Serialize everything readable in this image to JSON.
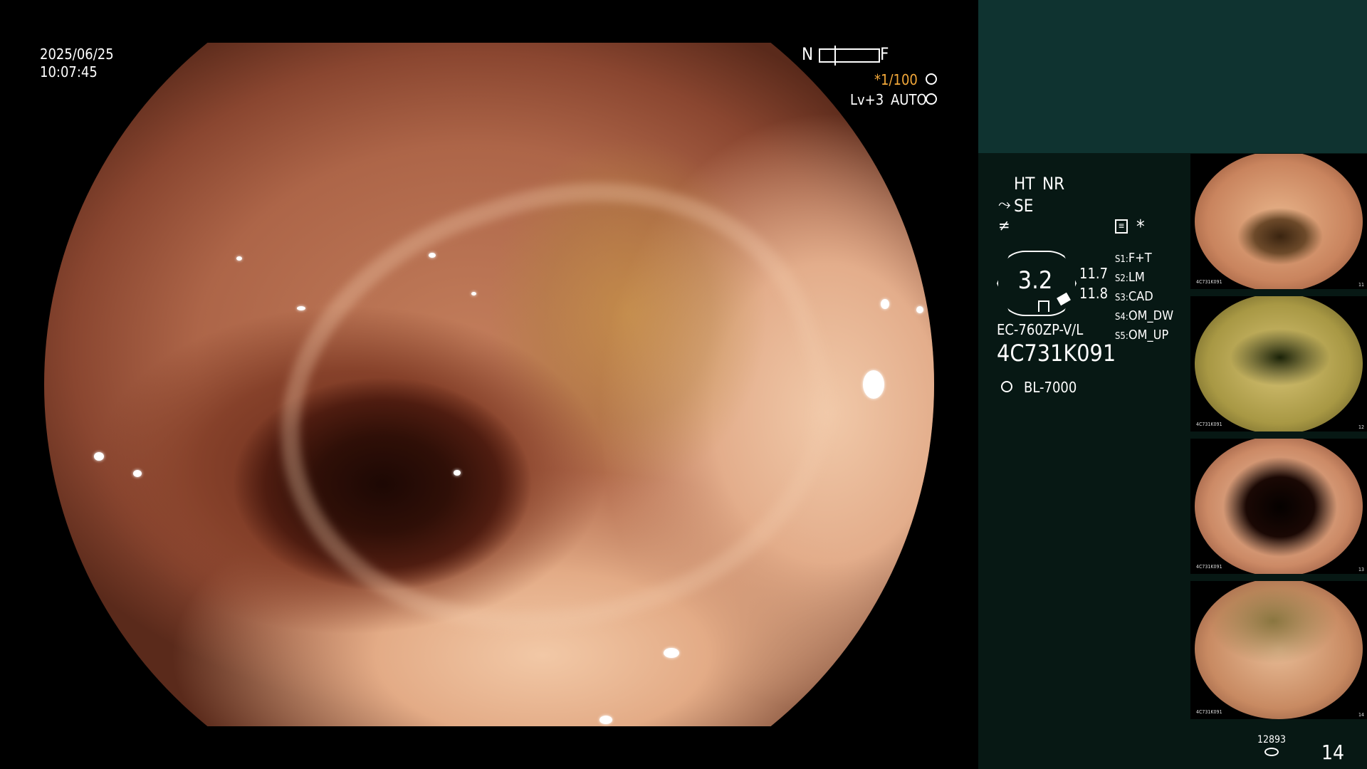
{
  "overlay": {
    "date": "2025/06/25",
    "time": "10:07:45",
    "focus_near": "N",
    "focus_far": "F",
    "shutter": "*1/100",
    "level": "Lv+3",
    "iris_mode": "AUTO"
  },
  "panel": {
    "mode_ht": "HT",
    "mode_nr": "NR",
    "mode_se": "SE",
    "asterisk": "*",
    "magnification": "3.2",
    "value_top": "11.7",
    "value_bottom": "11.8",
    "scope_model": "EC-760ZP-V/L",
    "scope_serial": "4C731K091",
    "light_source": "BL-7000",
    "switches": [
      {
        "key": "S1:",
        "value": "F+T"
      },
      {
        "key": "S2:",
        "value": "LM"
      },
      {
        "key": "S3:",
        "value": "CAD"
      },
      {
        "key": "S4:",
        "value": "OM_DW"
      },
      {
        "key": "S5:",
        "value": "OM_UP"
      }
    ],
    "storage_count": "12893",
    "image_count": "14"
  },
  "thumbnails": [
    {
      "label": "4C731K091",
      "index": "11"
    },
    {
      "label": "4C731K091",
      "index": "12"
    },
    {
      "label": "4C731K091",
      "index": "13"
    },
    {
      "label": "4C731K091",
      "index": "14"
    }
  ],
  "colors": {
    "accent_orange": "#f4a93a",
    "panel_bg": "#071814",
    "panel_top_bg": "#0f3330"
  },
  "icons": [
    "freeze-icon",
    "iris-icon",
    "scope-icon",
    "connector-icon",
    "memory-icon",
    "light-source-icon",
    "storage-icon"
  ]
}
